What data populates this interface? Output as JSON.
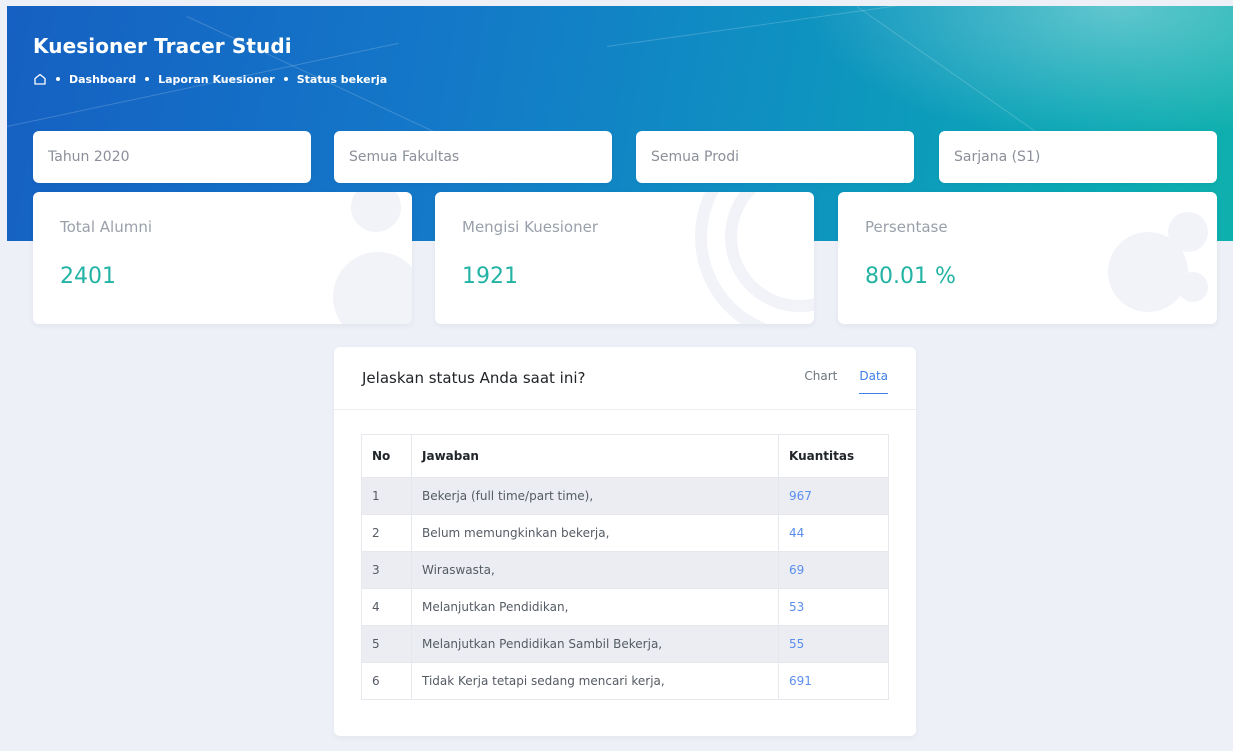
{
  "header": {
    "title": "Kuesioner Tracer Studi",
    "breadcrumb": [
      "Dashboard",
      "Laporan Kuesioner",
      "Status bekerja"
    ],
    "home_icon": "home-icon"
  },
  "filters": {
    "year": "Tahun 2020",
    "faculty": "Semua Fakultas",
    "prodi": "Semua Prodi",
    "level": "Sarjana (S1)"
  },
  "stats": [
    {
      "label": "Total Alumni",
      "value": "2401"
    },
    {
      "label": "Mengisi Kuesioner",
      "value": "1921"
    },
    {
      "label": "Persentase",
      "value": "80.01 %"
    }
  ],
  "card": {
    "title": "Jelaskan status Anda saat ini?",
    "tabs": [
      {
        "label": "Chart",
        "active": false
      },
      {
        "label": "Data",
        "active": true
      }
    ],
    "table": {
      "headers": [
        "No",
        "Jawaban",
        "Kuantitas"
      ],
      "rows": [
        [
          "1",
          "Bekerja (full time/part time),",
          "967"
        ],
        [
          "2",
          "Belum memungkinkan bekerja,",
          "44"
        ],
        [
          "3",
          "Wiraswasta,",
          "69"
        ],
        [
          "4",
          "Melanjutkan Pendidikan,",
          "53"
        ],
        [
          "5",
          "Melanjutkan Pendidikan Sambil Bekerja,",
          "55"
        ],
        [
          "6",
          "Tidak Kerja tetapi sedang mencari kerja,",
          "691"
        ]
      ]
    }
  },
  "colors": {
    "accent_teal": "#22b3a4",
    "link_blue": "#5b8def",
    "tab_active": "#3f7ee8"
  }
}
